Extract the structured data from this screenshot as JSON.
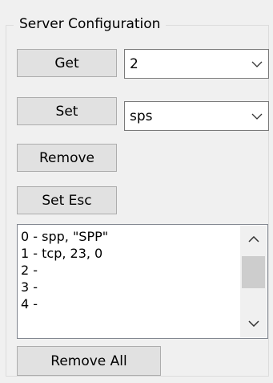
{
  "group": {
    "title": "Server Configuration"
  },
  "buttons": {
    "get": "Get",
    "set": "Set",
    "remove": "Remove",
    "set_esc": "Set Esc",
    "remove_all": "Remove All"
  },
  "get_combo": {
    "value": "2"
  },
  "set_combo": {
    "value": "sps"
  },
  "server_list": {
    "items": [
      "0 - spp, \"SPP\"",
      "1 - tcp, 23, 0",
      "2 -",
      "3 -",
      "4 -"
    ]
  },
  "icons": {
    "combo_arrow": "chevron-down-icon",
    "scroll_up": "scroll-up-arrow-icon",
    "scroll_down": "scroll-down-arrow-icon"
  },
  "colors": {
    "background": "#f0f0f0",
    "button_face": "#e1e1e1",
    "button_border": "#adadad",
    "input_border": "#7a7a7a"
  }
}
